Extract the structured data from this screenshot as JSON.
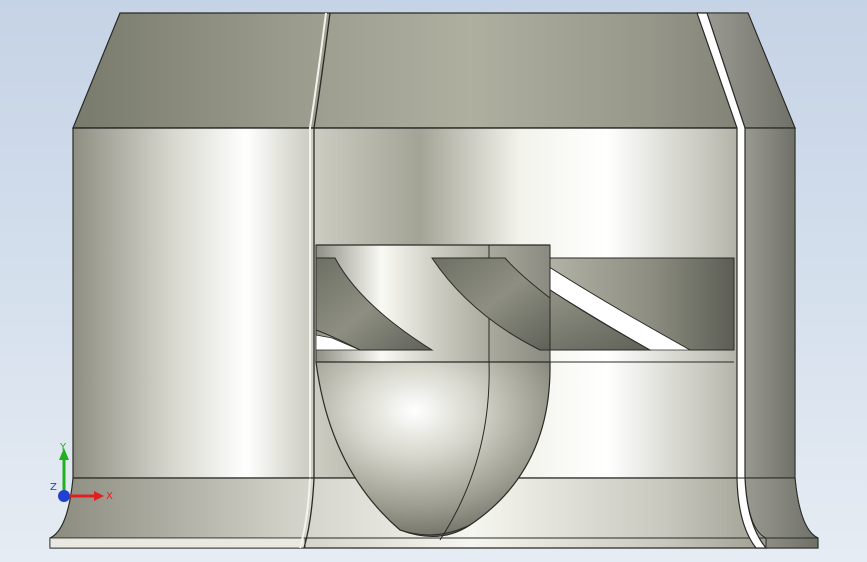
{
  "viewport": {
    "background_top": "#c5d3e6",
    "background_bottom": "#e6ecf3"
  },
  "triad": {
    "x_label": "X",
    "y_label": "Y",
    "z_label": "Z",
    "x_color": "#e02020",
    "y_color": "#20b020",
    "z_color": "#2040d0"
  },
  "model": {
    "shading": "metallic-gray",
    "components": [
      "upper-hood",
      "middle-housing",
      "base-flange",
      "hub-bottom-cap",
      "fan-blades",
      "hub-cylinder",
      "right-rib"
    ]
  }
}
